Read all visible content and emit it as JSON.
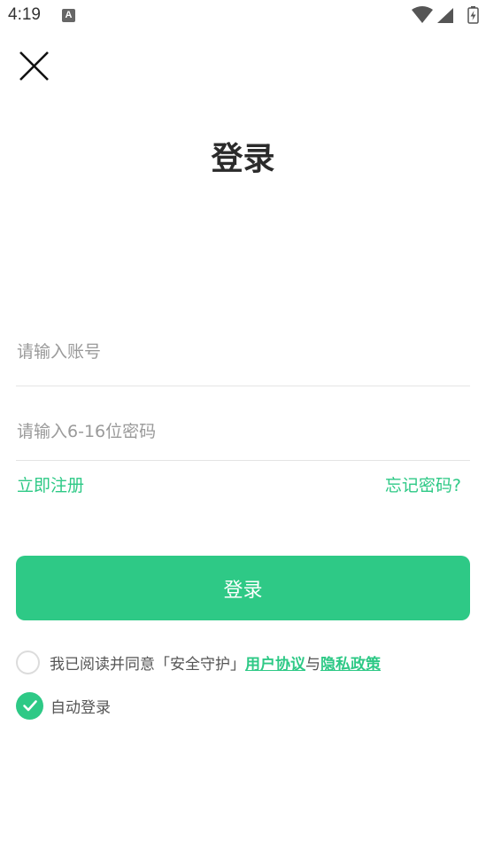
{
  "status_bar": {
    "time": "4:19",
    "notification_icon": "A"
  },
  "title": "登录",
  "account": {
    "placeholder": "请输入账号",
    "value": ""
  },
  "password": {
    "placeholder": "请输入6-16位密码",
    "value": ""
  },
  "links": {
    "register": "立即注册",
    "forgot": "忘记密码?"
  },
  "login_button": "登录",
  "agreement": {
    "prefix": "我已阅读并同意「安全守护」",
    "user_agreement": "用户协议",
    "connector": "与",
    "privacy_policy": "隐私政策",
    "checked": false
  },
  "auto_login": {
    "label": "自动登录",
    "checked": true
  },
  "colors": {
    "accent": "#2ec986",
    "text": "#2b2b2b",
    "placeholder": "#9a9a9a",
    "divider": "#e4e4e4"
  },
  "icons": {
    "close": "close-icon",
    "check": "check-icon",
    "wifi": "wifi-icon",
    "signal": "signal-icon",
    "battery": "battery-icon"
  }
}
